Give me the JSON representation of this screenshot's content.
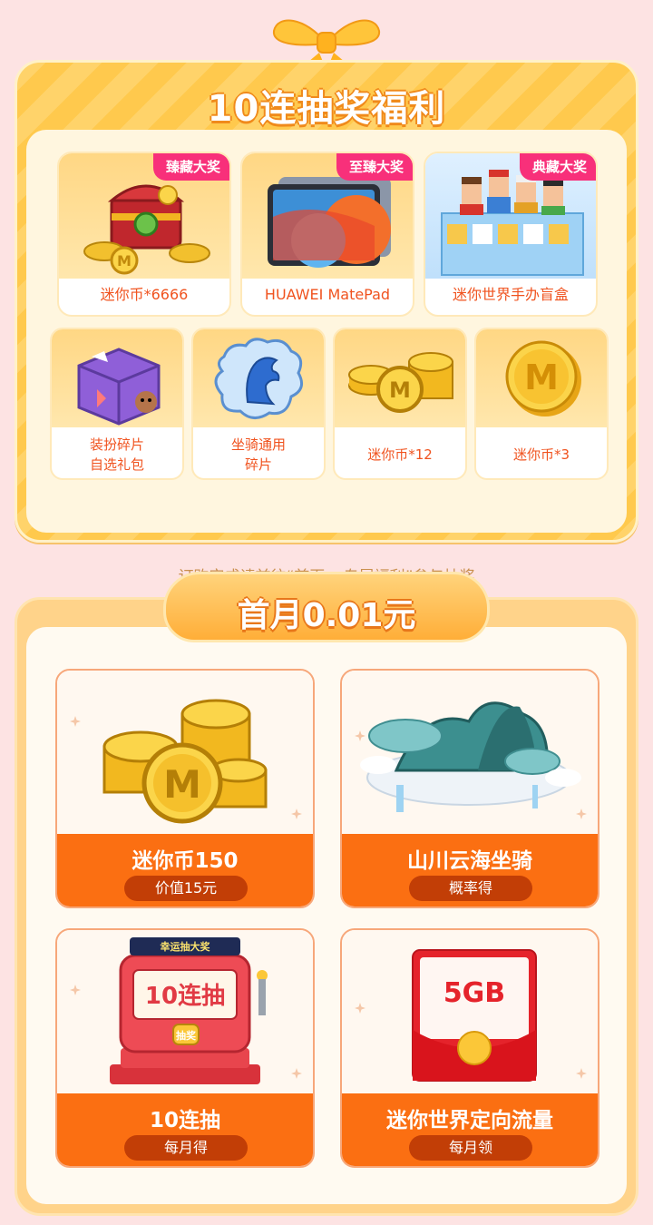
{
  "lottery": {
    "title": "10连抽奖福利",
    "big_prizes": [
      {
        "tag": "臻藏大奖",
        "label": "迷你币*6666",
        "icon": "treasure-chest-icon"
      },
      {
        "tag": "至臻大奖",
        "label": "HUAWEI MatePad",
        "icon": "tablet-icon"
      },
      {
        "tag": "典藏大奖",
        "label": "迷你世界手办盲盒",
        "icon": "figure-blind-box-icon"
      }
    ],
    "small_prizes": [
      {
        "label": "装扮碎片\n自选礼包",
        "icon": "gift-box-icon"
      },
      {
        "label": "坐骑通用\n碎片",
        "icon": "mount-fragment-icon"
      },
      {
        "label": "迷你币*12",
        "icon": "coin-stack-icon"
      },
      {
        "label": "迷你币*3",
        "icon": "coin-icon"
      }
    ],
    "note": "订购完成请前往“首页->专属福利”参与抽奖"
  },
  "first_month": {
    "title": "首月0.01元",
    "benefits": [
      {
        "title": "迷你币150",
        "pill": "价值15元",
        "icon": "coin-pile-icon"
      },
      {
        "title": "山川云海坐骑",
        "pill": "概率得",
        "icon": "floating-island-mount-icon"
      },
      {
        "title": "10连抽",
        "pill": "每月得",
        "icon": "lucky-draw-machine-icon",
        "machine_header": "幸运抽大奖",
        "machine_screen": "10连抽",
        "machine_button": "抽奖"
      },
      {
        "title": "迷你世界定向流量",
        "pill": "每月领",
        "icon": "data-red-packet-icon",
        "packet_text": "5GB"
      }
    ]
  },
  "colors": {
    "page_bg": "#fde3e3",
    "accent_orange": "#fb6f12",
    "tag_pink": "#f8307a",
    "gold": "#ffc94d"
  }
}
